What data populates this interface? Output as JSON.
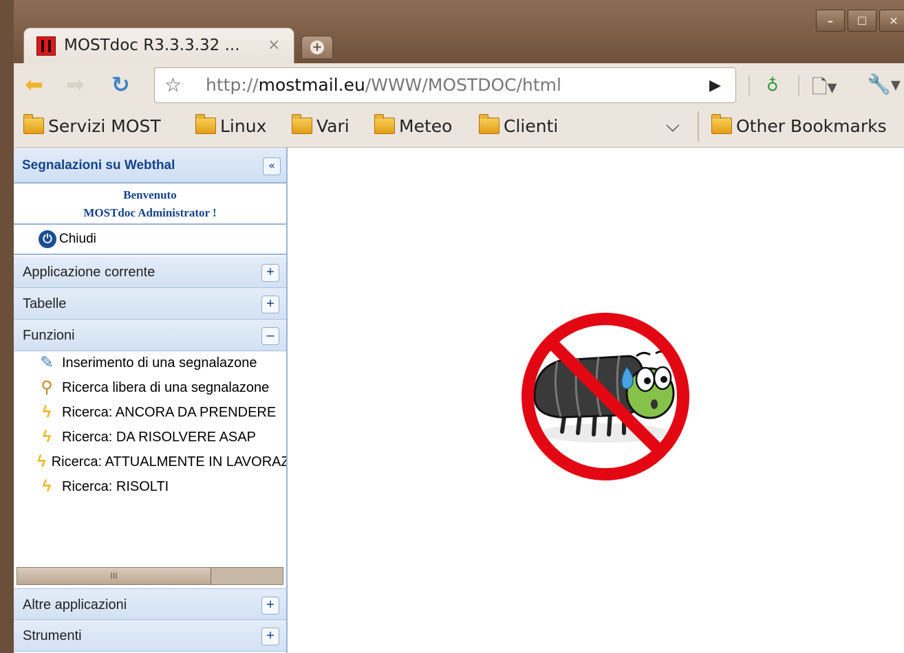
{
  "browser": {
    "tab_title": "MOSTdoc R3.3.3.32 ...",
    "tab_close": "×",
    "url_prefix": "http://",
    "url_domain": "mostmail.eu",
    "url_path": "/WWW/MOSTDOC/html",
    "window_controls": [
      "–",
      "☐",
      "✕"
    ]
  },
  "bookmarks": [
    {
      "label": "Servizi MOST"
    },
    {
      "label": "Linux"
    },
    {
      "label": "Vari"
    },
    {
      "label": "Meteo"
    },
    {
      "label": "Clienti"
    }
  ],
  "other_bookmarks": "Other Bookmarks",
  "panel": {
    "title": "Segnalazioni su Webthal",
    "collapse_glyph": "«",
    "welcome_line1": "Benvenuto",
    "welcome_line2": "MOSTdoc Administrator !",
    "close_label": "Chiudi",
    "sections_top": [
      {
        "label": "Applicazione corrente",
        "toggle": "+"
      },
      {
        "label": "Tabelle",
        "toggle": "+"
      },
      {
        "label": "Funzioni",
        "toggle": "–"
      }
    ],
    "functions": [
      {
        "label": "Inserimento di una segnalazone",
        "icon": "edit-icon"
      },
      {
        "label": "Ricerca libera di una segnalazone",
        "icon": "magnifier-icon"
      },
      {
        "label": "Ricerca: ANCORA DA PRENDERE",
        "icon": "lightning-icon"
      },
      {
        "label": "Ricerca: DA RISOLVERE ASAP",
        "icon": "lightning-icon"
      },
      {
        "label": "Ricerca: ATTUALMENTE IN LAVORAZIONE",
        "icon": "lightning-icon"
      },
      {
        "label": "Ricerca: RISOLTI",
        "icon": "lightning-icon"
      }
    ],
    "scroll_grip": "III",
    "sections_bottom": [
      {
        "label": "Altre applicazioni",
        "toggle": "+"
      },
      {
        "label": "Strumenti",
        "toggle": "+"
      }
    ]
  },
  "colors": {
    "panel_title": "#15428b",
    "prohibition_red": "#e30613"
  }
}
